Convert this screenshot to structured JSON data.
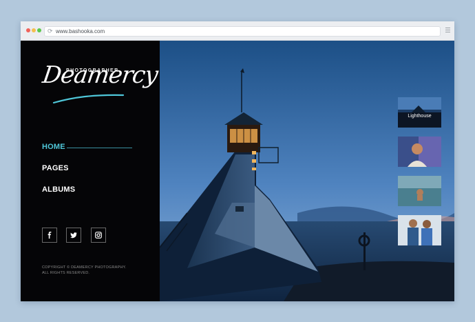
{
  "browser": {
    "url": "www.bashooka.com",
    "reload_icon": "reload-icon",
    "menu_icon": "hamburger-icon"
  },
  "brand": {
    "tagline": "PHOTOGRAPHER",
    "logo_text": "Deamercy",
    "accent": "#4fc7d9"
  },
  "nav": {
    "items": [
      {
        "label": "HOME",
        "active": true
      },
      {
        "label": "PAGES",
        "active": false
      },
      {
        "label": "ALBUMS",
        "active": false
      }
    ]
  },
  "social": [
    "facebook-icon",
    "twitter-icon",
    "instagram-icon"
  ],
  "footer": {
    "line1": "COPYRIGHT © DEAMERCY PHOTOGRAPHY.",
    "line2": "ALL RIGHTS RESERVED."
  },
  "gallery": {
    "thumbs": [
      {
        "caption": "Lighthouse"
      },
      {
        "caption": ""
      },
      {
        "caption": ""
      },
      {
        "caption": ""
      }
    ]
  }
}
